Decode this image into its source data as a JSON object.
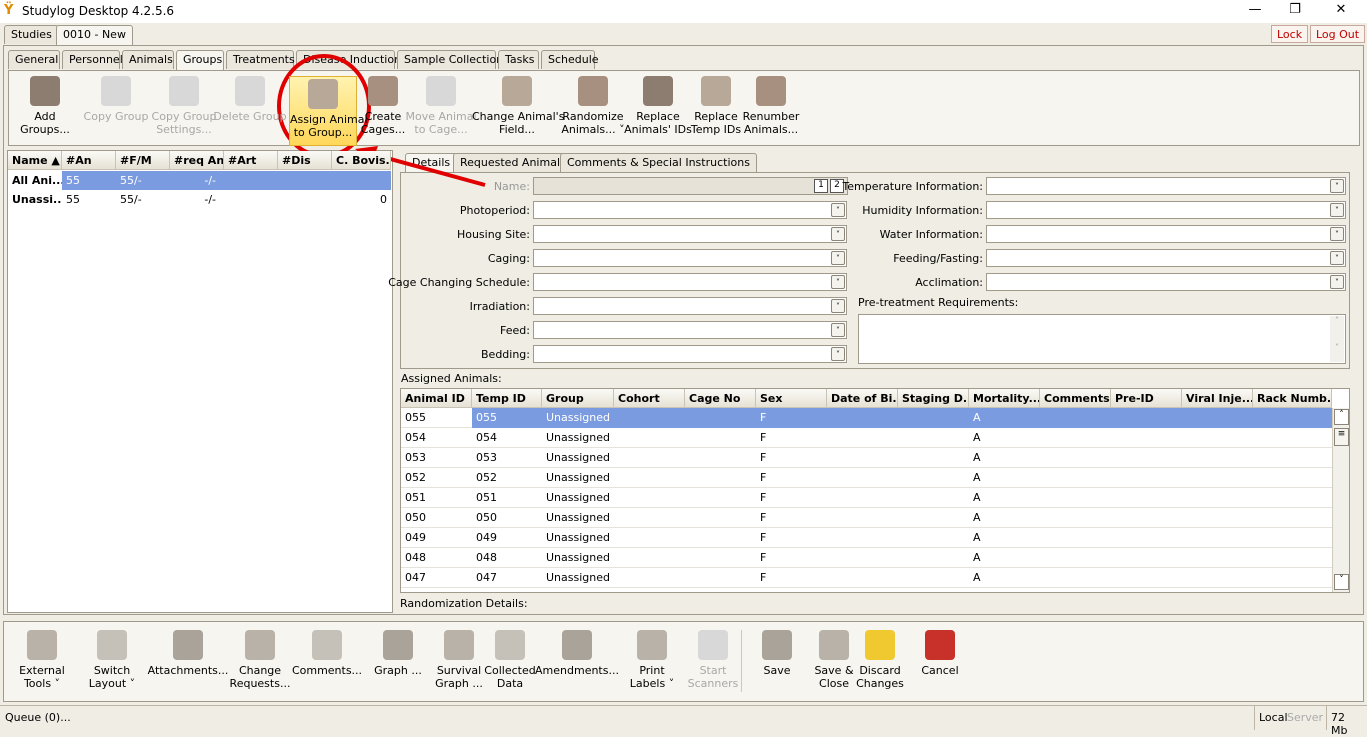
{
  "app": {
    "title": "Studylog Desktop 4.2.5.6",
    "minimize": "—",
    "restore": "❐",
    "close": "✕"
  },
  "study_tabs": [
    "Studies",
    "0010 - New"
  ],
  "header_buttons": {
    "lock": "Lock",
    "logout": "Log Out"
  },
  "section_tabs": [
    "General",
    "Personnel",
    "Animals",
    "Groups",
    "Treatments",
    "Disease Induction",
    "Sample Collection",
    "Tasks",
    "Schedule"
  ],
  "toolbar": [
    {
      "name": "add-groups",
      "label": "Add\nGroups...",
      "enabled": true
    },
    {
      "name": "copy-group",
      "label": "Copy Group",
      "enabled": false
    },
    {
      "name": "copy-group-settings",
      "label": "Copy Group\nSettings...",
      "enabled": false
    },
    {
      "name": "delete-group",
      "label": "Delete Group",
      "enabled": false
    },
    {
      "name": "assign-animal-to-group",
      "label": "Assign Animal\nto Group...",
      "enabled": true
    },
    {
      "name": "create-cages",
      "label": "Create\nCages...",
      "enabled": true
    },
    {
      "name": "move-animal-to-cage",
      "label": "Move Animal\nto Cage...",
      "enabled": false
    },
    {
      "name": "change-animals-field",
      "label": "Change Animal's\nField...",
      "enabled": true
    },
    {
      "name": "randomize-animals",
      "label": "Randomize\nAnimals... ˅",
      "enabled": true
    },
    {
      "name": "replace-animals-ids",
      "label": "Replace\nAnimals' IDs",
      "enabled": true
    },
    {
      "name": "replace-temp-ids",
      "label": "Replace\nTemp IDs",
      "enabled": true
    },
    {
      "name": "renumber-animals",
      "label": "Renumber\nAnimals...",
      "enabled": true
    }
  ],
  "groups_table": {
    "columns": [
      "Name ▲",
      "#An",
      "#F/M",
      "#req An",
      "#Art",
      "#Dis",
      "C. Bovis..."
    ],
    "rows": [
      [
        "All Ani...",
        "55",
        "55/-",
        "-/-",
        "",
        "",
        ""
      ],
      [
        "Unassi...",
        "55",
        "55/-",
        "-/-",
        "",
        "",
        "0"
      ]
    ]
  },
  "detail_tabs": [
    "Details",
    "Requested Animals",
    "Comments & Special Instructions"
  ],
  "form_left": [
    {
      "label": "Name:",
      "value": ""
    },
    {
      "label": "Photoperiod:"
    },
    {
      "label": "Housing Site:"
    },
    {
      "label": "Caging:"
    },
    {
      "label": "Cage Changing Schedule:"
    },
    {
      "label": "Irradiation:"
    },
    {
      "label": "Feed:"
    },
    {
      "label": "Bedding:"
    }
  ],
  "name_buttons": [
    "1",
    "2"
  ],
  "form_right": [
    {
      "label": "Temperature Information:"
    },
    {
      "label": "Humidity Information:"
    },
    {
      "label": "Water Information:"
    },
    {
      "label": "Feeding/Fasting:"
    },
    {
      "label": "Acclimation:"
    }
  ],
  "pretreatment_label": "Pre-treatment Requirements:",
  "assigned_label": "Assigned Animals:",
  "animals_table": {
    "columns": [
      "Animal ID",
      "Temp ID",
      "Group",
      "Cohort",
      "Cage No",
      "Sex",
      "Date of Bi...",
      "Staging D...",
      "Mortality...",
      "Comments",
      "Pre-ID",
      "Viral Inje...",
      "Rack Numb..."
    ],
    "rows": [
      [
        "055",
        "055",
        "Unassigned",
        "F",
        "A"
      ],
      [
        "054",
        "054",
        "Unassigned",
        "F",
        "A"
      ],
      [
        "053",
        "053",
        "Unassigned",
        "F",
        "A"
      ],
      [
        "052",
        "052",
        "Unassigned",
        "F",
        "A"
      ],
      [
        "051",
        "051",
        "Unassigned",
        "F",
        "A"
      ],
      [
        "050",
        "050",
        "Unassigned",
        "F",
        "A"
      ],
      [
        "049",
        "049",
        "Unassigned",
        "F",
        "A"
      ],
      [
        "048",
        "048",
        "Unassigned",
        "F",
        "A"
      ],
      [
        "047",
        "047",
        "Unassigned",
        "F",
        "A"
      ]
    ]
  },
  "randomization_label": "Randomization Details:",
  "bottom_toolbar": [
    {
      "name": "external-tools",
      "label": "External\nTools ˅",
      "enabled": true
    },
    {
      "name": "switch-layout",
      "label": "Switch\nLayout ˅",
      "enabled": true
    },
    {
      "name": "attachments",
      "label": "Attachments...",
      "enabled": true
    },
    {
      "name": "change-requests",
      "label": "Change\nRequests...",
      "enabled": true
    },
    {
      "name": "comments",
      "label": "Comments...",
      "enabled": true
    },
    {
      "name": "graph",
      "label": "Graph ...",
      "enabled": true
    },
    {
      "name": "survival-graph",
      "label": "Survival\nGraph ...",
      "enabled": true
    },
    {
      "name": "collected-data",
      "label": "Collected\nData",
      "enabled": true
    },
    {
      "name": "amendments",
      "label": "Amendments...",
      "enabled": true
    },
    {
      "name": "print-labels",
      "label": "Print\nLabels ˅",
      "enabled": true
    },
    {
      "name": "start-scanners",
      "label": "Start\nScanners",
      "enabled": false
    },
    {
      "name": "save",
      "label": "Save",
      "enabled": true
    },
    {
      "name": "save-and-close",
      "label": "Save &\nClose",
      "enabled": true
    },
    {
      "name": "discard-changes",
      "label": "Discard\nChanges",
      "enabled": true
    },
    {
      "name": "cancel",
      "label": "Cancel",
      "enabled": true
    }
  ],
  "status": {
    "queue": "Queue (0)...",
    "local": "Local",
    "server": "Server",
    "memory": "72 Mb"
  },
  "colors": {
    "selection": "#7b9be0",
    "accent": "#c00000",
    "highlight": "#ffd75a"
  }
}
